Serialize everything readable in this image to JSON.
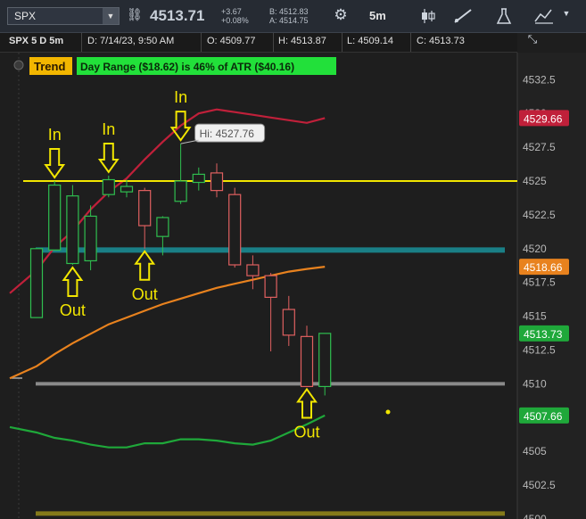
{
  "toolbar": {
    "symbol": "SPX",
    "last": "4513.71",
    "change": "+3.67",
    "change_pct": "+0.08%",
    "bid": "B: 4512.83",
    "ask": "A: 4514.75",
    "timeframe": "5m",
    "icons": [
      "dropdown-icon",
      "link-icon",
      "settings-gear-icon",
      "candle-style-icon",
      "drawing-tools-icon",
      "studies-flask-icon",
      "pattern-icon"
    ]
  },
  "infobar": {
    "title": "SPX 5 D 5m",
    "date": "D: 7/14/23, 9:50 AM",
    "open": "O: 4509.77",
    "high": "H: 4513.87",
    "low": "L: 4509.14",
    "close": "C: 4513.73"
  },
  "labels": {
    "trend": "Trend",
    "day_range": "Day Range ($18.62) is 46% of ATR ($40.16)",
    "hi_tooltip": "Hi: 4527.76",
    "in": "In",
    "out": "Out"
  },
  "colors": {
    "background": "#1e1e1e",
    "up_candle": "#2fbf4f",
    "down_candle": "#e06060",
    "upper_band": "#c0203a",
    "mid_band": "#e8821e",
    "lower_band": "#1fa83a",
    "resistance": "#f2e600",
    "teal_level": "#1a7f86",
    "gray_level": "#8a8a8a",
    "olive_level": "#857a1a",
    "arrow": "#f2e600"
  },
  "chart_data": {
    "type": "candlestick",
    "ylim": [
      4500,
      4534.5
    ],
    "y_ticks": [
      "4532.5",
      "4530",
      "4527.5",
      "4525",
      "4522.5",
      "4520",
      "4517.5",
      "4515",
      "4512.5",
      "4510",
      "4507.5",
      "4505",
      "4502.5",
      "4500"
    ],
    "candles": [
      {
        "o": 4514.9,
        "h": 4520.0,
        "l": 4514.9,
        "c": 4520.0
      },
      {
        "o": 4519.9,
        "h": 4525.0,
        "l": 4519.9,
        "c": 4524.7
      },
      {
        "o": 4518.9,
        "h": 4524.7,
        "l": 4518.8,
        "c": 4523.9
      },
      {
        "o": 4519.1,
        "h": 4523.2,
        "l": 4518.4,
        "c": 4522.4
      },
      {
        "o": 4524.0,
        "h": 4525.4,
        "l": 4523.8,
        "c": 4525.1
      },
      {
        "o": 4524.2,
        "h": 4525.1,
        "l": 4523.8,
        "c": 4524.6
      },
      {
        "o": 4524.3,
        "h": 4524.5,
        "l": 4520.0,
        "c": 4521.7
      },
      {
        "o": 4520.9,
        "h": 4522.4,
        "l": 4519.5,
        "c": 4522.3
      },
      {
        "o": 4523.5,
        "h": 4527.76,
        "l": 4523.3,
        "c": 4525.0
      },
      {
        "o": 4524.9,
        "h": 4526.0,
        "l": 4524.3,
        "c": 4525.5
      },
      {
        "o": 4525.6,
        "h": 4526.3,
        "l": 4523.8,
        "c": 4524.3
      },
      {
        "o": 4524.0,
        "h": 4524.5,
        "l": 4518.6,
        "c": 4518.8
      },
      {
        "o": 4518.8,
        "h": 4519.5,
        "l": 4517.0,
        "c": 4518.0
      },
      {
        "o": 4518.0,
        "h": 4518.2,
        "l": 4512.4,
        "c": 4516.4
      },
      {
        "o": 4515.5,
        "h": 4516.5,
        "l": 4512.8,
        "c": 4513.6
      },
      {
        "o": 4513.5,
        "h": 4514.3,
        "l": 4509.8,
        "c": 4509.8
      },
      {
        "o": 4509.8,
        "h": 4513.7,
        "l": 4509.14,
        "c": 4513.73
      }
    ],
    "upper_band": [
      4518.4,
      4520.1,
      4521.3,
      4522.9,
      4524.2,
      4525.2,
      4526.6,
      4527.9,
      4529.1,
      4530.0,
      4530.3,
      4530.1,
      4529.9,
      4529.7,
      4529.5,
      4529.3,
      4529.66
    ],
    "mid_band": [
      4511.3,
      4512.2,
      4513.0,
      4513.7,
      4514.4,
      4514.9,
      4515.4,
      4515.9,
      4516.3,
      4516.7,
      4517.1,
      4517.4,
      4517.7,
      4518.0,
      4518.3,
      4518.5,
      4518.66
    ],
    "lower_band": [
      4506.4,
      4506.0,
      4505.8,
      4505.5,
      4505.3,
      4505.3,
      4505.6,
      4505.6,
      4505.9,
      4505.9,
      4505.8,
      4505.6,
      4505.5,
      4505.8,
      4506.4,
      4507.0,
      4507.66
    ],
    "levels": {
      "resistance": 4525.0,
      "teal": 4519.9,
      "gray": 4510.0,
      "olive": 4500.4
    },
    "price_badges": [
      {
        "value": "4529.66",
        "color": "#c0203a"
      },
      {
        "value": "4518.66",
        "color": "#e8821e"
      },
      {
        "value": "4513.73",
        "color": "#1fa83a"
      },
      {
        "value": "4507.66",
        "color": "#1fa83a"
      }
    ],
    "annotations": [
      {
        "text": "In",
        "candle": 1,
        "kind": "in"
      },
      {
        "text": "In",
        "candle": 4,
        "kind": "in"
      },
      {
        "text": "In",
        "candle": 8,
        "kind": "in"
      },
      {
        "text": "Out",
        "candle": 2,
        "kind": "out"
      },
      {
        "text": "Out",
        "candle": 6,
        "kind": "out"
      },
      {
        "text": "Out",
        "candle": 15,
        "kind": "out"
      }
    ]
  }
}
